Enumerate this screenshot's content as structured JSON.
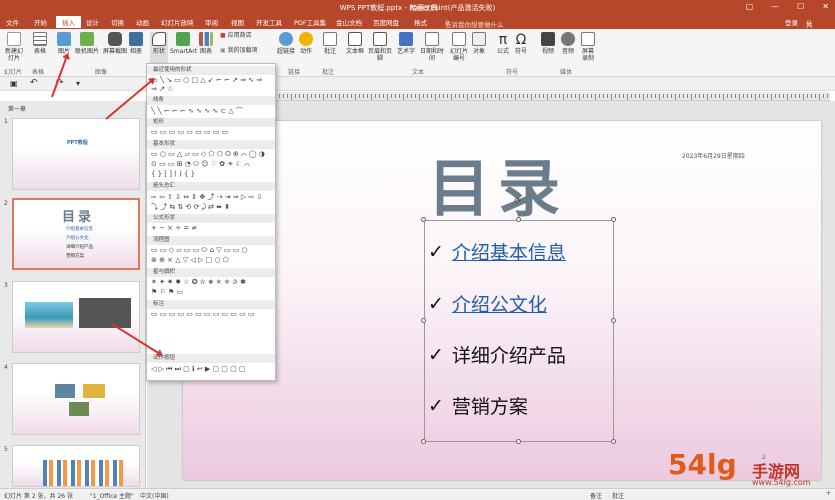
{
  "window": {
    "title": "WPS PPT教程.pptx - PowerPoint(产品激活失败)",
    "context_tab": "绘图工具"
  },
  "menu": {
    "items": [
      "文件",
      "开始",
      "插入",
      "设计",
      "切换",
      "动画",
      "幻灯片放映",
      "审阅",
      "视图",
      "开发工具",
      "PDF工具集",
      "金山文档",
      "百度网盘",
      "格式"
    ],
    "active": "插入",
    "search_placeholder": "告诉我你想要做什么",
    "login": "登录",
    "share": "共享"
  },
  "ribbon": {
    "buttons": [
      "新建幻灯片",
      "表格",
      "图片",
      "联机图片",
      "屏幕截图",
      "相册",
      "形状",
      "SmartArt",
      "图表",
      "应用商店",
      "我的加载项",
      "超链接",
      "动作",
      "批注",
      "文本框",
      "页眉和页脚",
      "艺术字",
      "日期和时间",
      "幻灯片编号",
      "对象",
      "公式",
      "符号",
      "视频",
      "音频",
      "屏幕录制"
    ],
    "groups": [
      "幻灯片",
      "表格",
      "图像",
      "链接",
      "批注",
      "文本",
      "符号",
      "媒体"
    ]
  },
  "dropdown": {
    "sections": [
      "最近使用的形状",
      "线条",
      "矩形",
      "基本形状",
      "箭头总汇",
      "公式形状",
      "流程图",
      "星与旗帜",
      "标注",
      "动作按钮"
    ],
    "rows": [
      "▭╲↘▭○□△↙⌐⌐↗⇒∿⇒",
      "⇒↗☆",
      "╲╲⌐⌐⌐∿∿∿∿⊂△⌒",
      "▭▭▭▭▭▭▭▭▭",
      "▭○▭△▱▭◇⬠⬡⭘⊕⌒◯◑",
      "⊙▭▭⊞◔⬭☺♡✿☀☾⌒",
      "{}[](){}",
      "⇨⇦⇧⇩⇔⇕✥⤴⇢⇥⇒▷⇨⇩",
      "⤵⤴⇆⇅⟲⟳⤸⇄⬌⬍",
      "+−×÷=≠",
      "▭▭◇▱▭▭⬭⌂▽▭▭○",
      "⊗⊕⨯△▽◁▷□○⬠",
      "✶✦✷✸☆✪✫✬✭✯✰✱",
      "⚑⚐⚑▭",
      "▭▭▭▭▭▭▭▭▭▭▭▭",
      "◁▷⏮⏭▢ℹ↩▶▢▢▢▢"
    ]
  },
  "thumbs": {
    "section_label": "第一章",
    "slide1_title": "PPT教程",
    "slide2_title": "目录",
    "slide2_items": [
      "介绍基本信息",
      "介绍公文化",
      "详细介绍产品",
      "营销方案"
    ]
  },
  "slide": {
    "date": "2023年6月29日星期四",
    "title": "目录",
    "bullets": [
      {
        "text": "介绍基本信息",
        "link": true
      },
      {
        "text": "介绍公文化",
        "link": true
      },
      {
        "text": "详细介绍产品",
        "link": false
      },
      {
        "text": "营销方案",
        "link": false
      }
    ]
  },
  "status": {
    "slide_info": "幻灯片 第 2 张，共 26 张",
    "theme": "\"1_Office 主题\"",
    "language": "中文(中国)",
    "notes": "备注",
    "comments": "批注",
    "zoom": "+"
  },
  "watermark": {
    "main": "54lg",
    "side": "手游网",
    "url": "www.54lg.com"
  },
  "colors": {
    "accent": "#b7472a",
    "link": "#1f5fa8",
    "arrow": "#d9342b"
  }
}
